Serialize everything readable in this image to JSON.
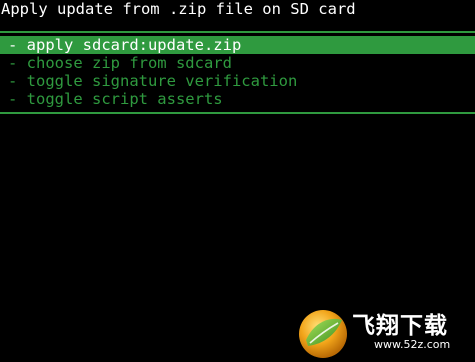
{
  "screen": {
    "title": "Apply update from .zip file on SD card"
  },
  "menu": {
    "items": [
      {
        "label": "- apply sdcard:update.zip",
        "selected": true
      },
      {
        "label": "- choose zip from sdcard",
        "selected": false
      },
      {
        "label": "- toggle signature verification",
        "selected": false
      },
      {
        "label": "- toggle script asserts",
        "selected": false
      }
    ]
  },
  "watermark": {
    "brand": "飞翔下载",
    "url": "www.52z.com",
    "logo_icon": "leaf-orb-logo"
  },
  "colors": {
    "background": "#000000",
    "accent": "#2f9a3f",
    "title_text": "#ffffff"
  }
}
